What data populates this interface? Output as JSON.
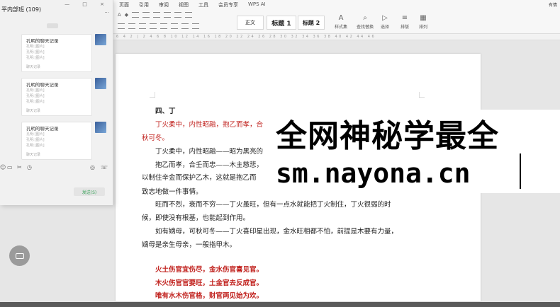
{
  "menu": {
    "items": [
      "页面",
      "引用",
      "审阅",
      "视图",
      "工具",
      "会员专享",
      "WPS AI"
    ]
  },
  "ribbon": {
    "styles": {
      "normal": "正文",
      "heading1": "标题 1",
      "heading2": "标题 2"
    },
    "tools": [
      {
        "label": "样式集",
        "icon": "style-set-icon",
        "glyph": "A"
      },
      {
        "label": "查找替换",
        "icon": "search-icon",
        "glyph": "⌕"
      },
      {
        "label": "选择",
        "icon": "select-icon",
        "glyph": "▷"
      },
      {
        "label": "排版",
        "icon": "layout-icon",
        "glyph": "≡"
      },
      {
        "label": "排列",
        "icon": "arrange-icon",
        "glyph": "▦"
      }
    ],
    "user": "有情"
  },
  "chat": {
    "title": "平内部班 (109)",
    "window_controls": "— □ ×",
    "more": "...",
    "messages": [
      {
        "title": "孔明的聊天记录",
        "lines": [
          "孔明:[图片]",
          "孔明:[图片]",
          "孔明:[图片]"
        ],
        "footer": "聊天记录"
      },
      {
        "title": "孔明的聊天记录",
        "lines": [
          "孔明:[图片]",
          "孔明:[图片]",
          "孔明:[图片]"
        ],
        "footer": "聊天记录"
      },
      {
        "title": "孔明的聊天记录",
        "lines": [
          "孔明:[图片]",
          "孔明:[图片]",
          "孔明:[图片]"
        ],
        "footer": "聊天记录"
      }
    ],
    "send_label": "发送(S)"
  },
  "document": {
    "heading": "四、丁",
    "lines": [
      {
        "text": "丁火柔中，内性昭融，抱乙而孝，合",
        "red": true
      },
      {
        "text": "秋可冬。",
        "red": true
      },
      {
        "text": "丁火柔中，内性昭融——昭为黑亮的",
        "red": false
      },
      {
        "text": "抱乙而孝，合壬而忠——木主慈悲，",
        "red": false
      },
      {
        "text": "以制住辛金而保护乙木，这就是抱乙而",
        "red": false
      },
      {
        "text": "致志地做一件事情。",
        "red": false
      },
      {
        "text": "旺而不烈，衰而不穷——丁火虽旺，但有一点水就能把丁火制住，丁火很弱的时",
        "red": false
      },
      {
        "text": "候，即使没有根基，也能起到作用。",
        "red": false
      },
      {
        "text": "如有嫡母，可秋可冬——丁火喜印星出现，金水旺相都不怕，前提是木要有力量，",
        "red": false
      },
      {
        "text": "嫡母是亲生母亲，一般指甲木。",
        "red": false
      },
      {
        "text": "火土伤官宜伤尽，金水伤官喜见官。",
        "red": true
      },
      {
        "text": "木火伤官官要旺，土金官去反成官。",
        "red": true
      },
      {
        "text": "唯有水木伤官格，财官两见始为欢。",
        "red": true
      }
    ]
  },
  "watermark": {
    "line1": "全网神秘学最全",
    "line2": "sm.nayona.cn"
  },
  "ruler_text": "6 4 2 | 2 4 6 8 10 12 14 16 18 20 22 24 26 28 30 32 34 36 38 40 42 44 46",
  "colors": {
    "accent_red": "#c0201c",
    "send_green": "#3aa35a"
  }
}
